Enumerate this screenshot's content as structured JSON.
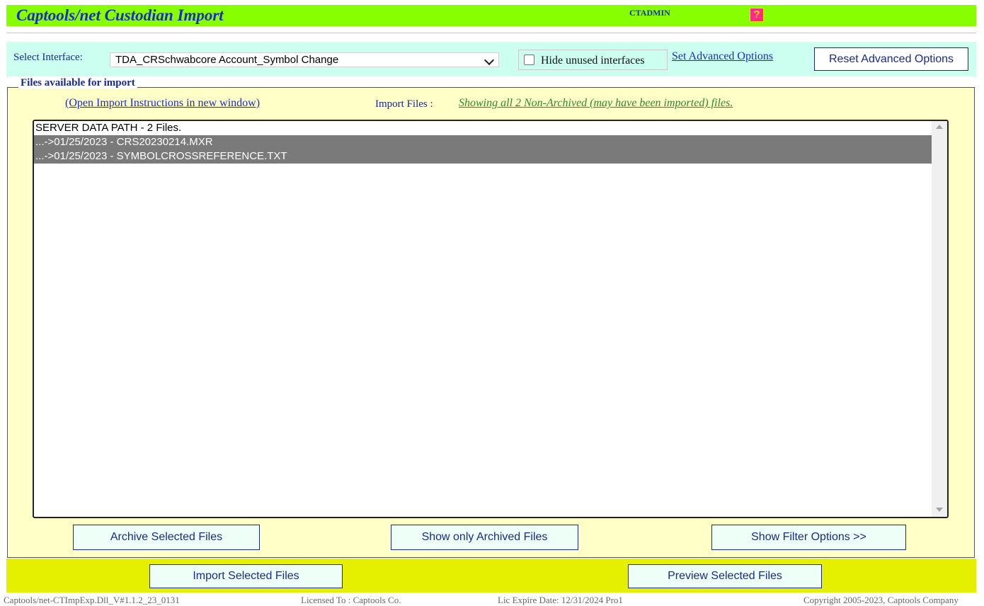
{
  "header": {
    "title": "Captools/net Custodian Import",
    "user": "CTADMIN",
    "help_symbol": "?"
  },
  "interface": {
    "label": "Select Interface:",
    "selected": "TDA_CRSchwabcore Account_Symbol Change",
    "hide_unused_label": "Hide unused interfaces",
    "hide_unused_checked": false,
    "advanced_link": "Set Advanced Options",
    "reset_button": "Reset Advanced Options"
  },
  "files": {
    "legend": "Files available for import",
    "instructions_link": "(Open Import Instructions in new window)",
    "import_files_label": "Import Files :",
    "status": "Showing all 2 Non-Archived (may have been imported) files.",
    "list_header": "SERVER DATA PATH - 2 Files.",
    "items": [
      {
        "label": "...->01/25/2023 - CRS20230214.MXR",
        "selected": true
      },
      {
        "label": "...->01/25/2023 - SYMBOLCROSSREFERENCE.TXT",
        "selected": true
      }
    ],
    "buttons": {
      "archive": "Archive Selected Files",
      "show_archived": "Show only Archived Files",
      "filter": "Show Filter Options >>"
    }
  },
  "actions": {
    "import": "Import Selected Files",
    "preview": "Preview Selected Files"
  },
  "footer": {
    "version": "Captools/net-CTImpExp.Dll_V#1.1.2_23_0131",
    "licensed": "Licensed To : Captools Co.",
    "expire": "Lic Expire Date: 12/31/2024 Pro1",
    "copyright": "Copyright 2005-2023, Captools Company"
  },
  "colors": {
    "header_bg": "#88ff00",
    "interface_bar_bg": "#ccfff0",
    "files_panel_bg": "#ffffc8",
    "action_bar_bg": "#e4f000",
    "selected_row_bg": "#7a7a7a",
    "accent_text": "#1a2cc8"
  }
}
